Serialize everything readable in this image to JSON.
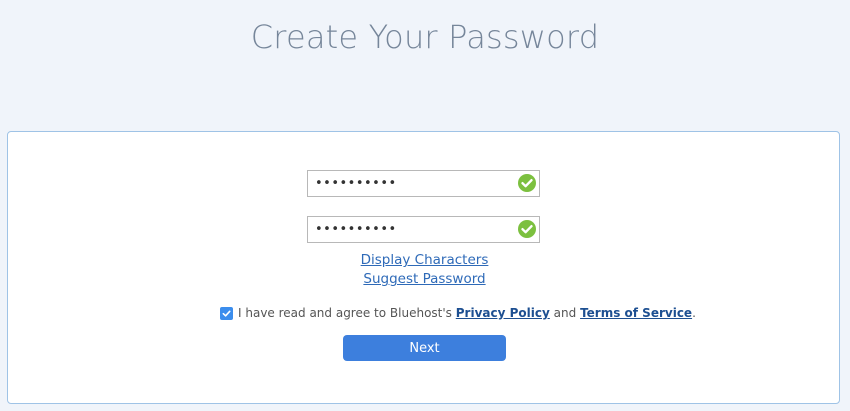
{
  "header": {
    "title": "Create Your Password"
  },
  "form": {
    "password_value": "••••••••••",
    "confirm_value": "••••••••••",
    "display_characters": "Display Characters",
    "suggest_password": "Suggest Password",
    "agree": {
      "checked": true,
      "prefix": "I have read and agree to Bluehost's",
      "privacy_policy": "Privacy Policy",
      "and": "and",
      "terms_of_service": "Terms of Service",
      "suffix": "."
    },
    "next_label": "Next"
  },
  "colors": {
    "accent": "#3d7fdd",
    "valid": "#7cc03f",
    "link": "#2e6ab8",
    "background": "#f0f4fa",
    "card_border": "#9fc3e6"
  },
  "icons": [
    "check-circle-icon",
    "checkbox-checked-icon"
  ]
}
